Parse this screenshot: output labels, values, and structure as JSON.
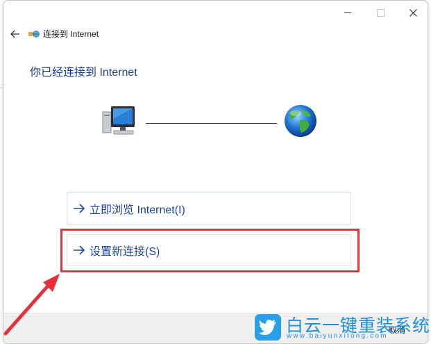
{
  "window": {
    "title": "连接到 Internet",
    "controls": {
      "minimize": "minimize",
      "maximize": "maximize",
      "close": "close"
    }
  },
  "main": {
    "status_text": "你已经连接到 Internet",
    "diagram": {
      "computer_icon": "computer-monitor-icon",
      "globe_icon": "globe-icon"
    },
    "options": [
      {
        "label": "立即浏览 Internet(I)"
      },
      {
        "label": "设置新连接(S)"
      }
    ]
  },
  "footer": {
    "cancel_label": "取消"
  },
  "watermark": {
    "title": "白云一键重装系统",
    "url": "www.baiyunxitong.com"
  },
  "colors": {
    "accent_text": "#1b46a0",
    "highlight": "#e3303a",
    "watermark": "#1e8fdc"
  }
}
